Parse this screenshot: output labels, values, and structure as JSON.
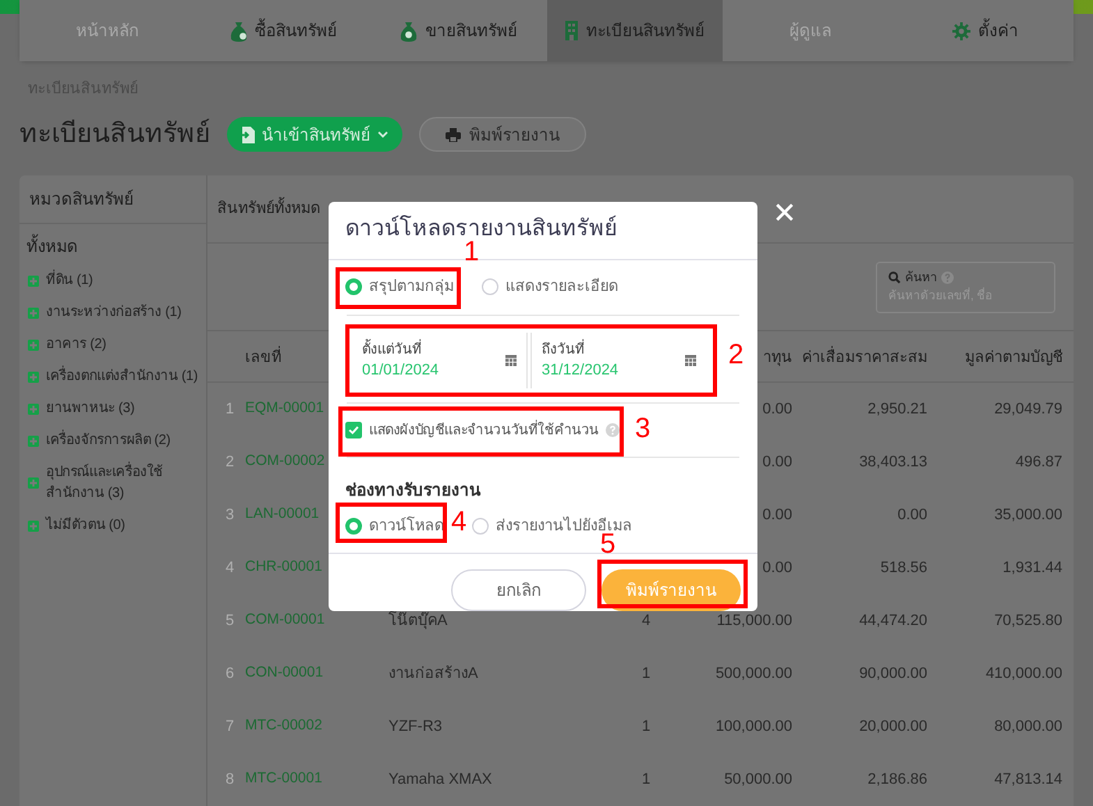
{
  "nav_tabs": [
    {
      "label": "หน้าหลัก",
      "selected": false,
      "disabled": true
    },
    {
      "label": "ซื้อสินทรัพย์",
      "selected": false,
      "disabled": false
    },
    {
      "label": "ขายสินทรัพย์",
      "selected": false,
      "disabled": false
    },
    {
      "label": "ทะเบียนสินทรัพย์",
      "selected": true,
      "disabled": false
    },
    {
      "label": "ผู้ดูแล",
      "selected": false,
      "disabled": true
    },
    {
      "label": "ตั้งค่า",
      "selected": false,
      "disabled": false
    }
  ],
  "breadcrumb": "ทะเบียนสินทรัพย์",
  "page_title": "ทะเบียนสินทรัพย์",
  "import_button": "นำเข้าสินทรัพย์",
  "print_button": "พิมพ์รายงาน",
  "sidebar": {
    "title": "หมวดสินทรัพย์",
    "all": "ทั้งหมด",
    "items": [
      "ที่ดิน (1)",
      "งานระหว่างก่อสร้าง (1)",
      "อาคาร (2)",
      "เครื่องตกแต่งสำนักงาน (1)",
      "ยานพาหนะ (3)",
      "เครื่องจักรการผลิต (2)",
      "อุปกรณ์และเครื่องใช้สำนักงาน (3)",
      "ไม่มีตัวตน (0)"
    ]
  },
  "table": {
    "title": "สินทรัพย์ทั้งหมด",
    "search": {
      "label": "ค้นหา",
      "placeholder": "ค้นหาด้วยเลขที่, ชื่อ"
    },
    "columns": {
      "code": "เลขที่",
      "cost": "าทุน",
      "depreciation": "ค่าเสื่อมราคาสะสม",
      "book_value": "มูลค่าตามบัญชี"
    },
    "rows": [
      {
        "index": "1",
        "code": "EQM-00001",
        "cost": "0.00",
        "depreciation": "2,950.21",
        "book_value": "29,049.79"
      },
      {
        "index": "2",
        "code": "COM-00002",
        "cost": "0.00",
        "depreciation": "38,403.13",
        "book_value": "496.87"
      },
      {
        "index": "3",
        "code": "LAN-00001",
        "cost": "0.00",
        "depreciation": "0.00",
        "book_value": "35,000.00"
      },
      {
        "index": "4",
        "code": "CHR-00001",
        "cost": "0.00",
        "depreciation": "518.56",
        "book_value": "1,931.44"
      },
      {
        "index": "5",
        "code": "COM-00001",
        "name": "โน๊ตบุ๊คA",
        "qty": "4",
        "cost": "115,000.00",
        "depreciation": "44,474.20",
        "book_value": "70,525.80"
      },
      {
        "index": "6",
        "code": "CON-00001",
        "name": "งานก่อสร้างA",
        "qty": "1",
        "cost": "500,000.00",
        "depreciation": "90,000.00",
        "book_value": "410,000.00"
      },
      {
        "index": "7",
        "code": "MTC-00002",
        "name": "YZF-R3",
        "qty": "1",
        "cost": "100,000.00",
        "depreciation": "20,000.00",
        "book_value": "80,000.00"
      },
      {
        "index": "8",
        "code": "MTC-00001",
        "name": "Yamaha XMAX",
        "qty": "1",
        "cost": "50,000.00",
        "depreciation": "2,186.86",
        "book_value": "47,813.14"
      }
    ]
  },
  "dialog": {
    "title": "ดาวน์โหลดรายงานสินทรัพย์",
    "report_types": [
      {
        "label": "สรุปตามกลุ่ม",
        "selected": true
      },
      {
        "label": "แสดงรายละเอียด",
        "selected": false
      }
    ],
    "date_fields": [
      {
        "label": "ตั้งแต่วันที่",
        "value": "01/01/2024"
      },
      {
        "label": "ถึงวันที่",
        "value": "31/12/2024"
      }
    ],
    "show_accounts": {
      "label": "แสดงผังบัญชีและจำนวนวันที่ใช้คำนวน",
      "checked": true
    },
    "channel_title": "ช่องทางรับรายงาน",
    "channels": [
      {
        "label": "ดาวน์โหลด",
        "selected": true
      },
      {
        "label": "ส่งรายงานไปยังอีเมล",
        "selected": false
      }
    ],
    "cancel_button": "ยกเลิก",
    "confirm_button": "พิมพ์รายงาน"
  },
  "annotations": [
    {
      "label": "1"
    },
    {
      "label": "2"
    },
    {
      "label": "3"
    },
    {
      "label": "4"
    },
    {
      "label": "5"
    }
  ]
}
